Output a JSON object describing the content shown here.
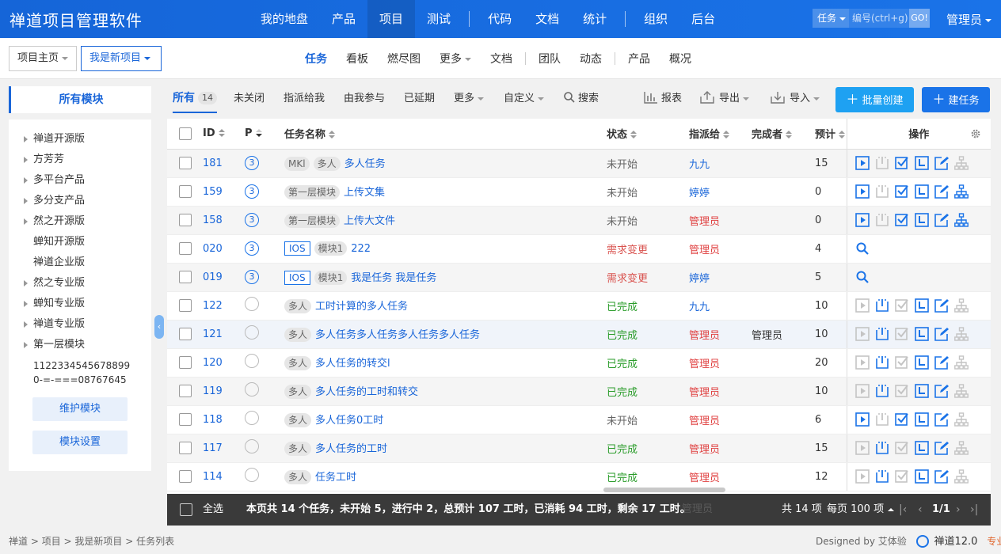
{
  "app": {
    "title": "禅道项目管理软件"
  },
  "main_nav": {
    "items": [
      "我的地盘",
      "产品",
      "项目",
      "测试",
      "代码",
      "文档",
      "统计",
      "组织",
      "后台"
    ],
    "active": "项目"
  },
  "search": {
    "type_label": "任务",
    "placeholder": "编号(ctrl+g)",
    "go_label": "GO!"
  },
  "user": {
    "name": "管理员"
  },
  "breadcrumb": {
    "home": "项目主页",
    "project": "我是新项目"
  },
  "sub_nav": {
    "items": [
      "任务",
      "看板",
      "燃尽图",
      "更多",
      "文档",
      "团队",
      "动态",
      "产品",
      "概况"
    ],
    "active": "任务"
  },
  "sidebar": {
    "title": "所有模块",
    "modules": [
      {
        "label": "禅道开源版",
        "expandable": true
      },
      {
        "label": "方芳芳",
        "expandable": true
      },
      {
        "label": "多平台产品",
        "expandable": true
      },
      {
        "label": "多分支产品",
        "expandable": true
      },
      {
        "label": "然之开源版",
        "expandable": true
      },
      {
        "label": "蝉知开源版",
        "expandable": false
      },
      {
        "label": "禅道企业版",
        "expandable": false
      },
      {
        "label": "然之专业版",
        "expandable": true
      },
      {
        "label": "蝉知专业版",
        "expandable": true
      },
      {
        "label": "禅道专业版",
        "expandable": true
      },
      {
        "label": "第一层模块",
        "expandable": true
      }
    ],
    "long_module_line1": "1122334545678899",
    "long_module_line2": "0-=-===08767645",
    "maintain_button": "维护模块",
    "settings_button": "模块设置"
  },
  "toolbar": {
    "all_label": "所有",
    "all_count": "14",
    "unclosed": "未关闭",
    "assigned_to_me": "指派给我",
    "involved": "由我参与",
    "delayed": "已延期",
    "more": "更多",
    "custom": "自定义",
    "search": "搜索",
    "report": "报表",
    "export": "导出",
    "import": "导入",
    "batch_create": "批量创建",
    "create_task": "建任务"
  },
  "table": {
    "headers": {
      "id": "ID",
      "pri": "P",
      "name": "任务名称",
      "status": "状态",
      "assigned": "指派给",
      "finished_by": "完成者",
      "estimate": "预计",
      "actions": "操作"
    },
    "rows": [
      {
        "id": "181",
        "pri": "3",
        "tags": [
          {
            "text": "MKl",
            "style": "pill"
          },
          {
            "text": "多人",
            "style": "pill"
          }
        ],
        "name": "多人任务",
        "status": "未开始",
        "status_color": "gray",
        "assigned": "九九",
        "assigned_color": "blue",
        "finished_by": "",
        "estimate": "15",
        "ops": "full-active-tree",
        "shade": true
      },
      {
        "id": "159",
        "pri": "3",
        "tags": [
          {
            "text": "第一层模块",
            "style": "pill"
          }
        ],
        "name": "上传文集",
        "status": "未开始",
        "status_color": "gray",
        "assigned": "婷婷",
        "assigned_color": "blue",
        "finished_by": "",
        "estimate": "0",
        "ops": "full-active-treeblue",
        "shade": false
      },
      {
        "id": "158",
        "pri": "3",
        "tags": [
          {
            "text": "第一层模块",
            "style": "pill"
          }
        ],
        "name": "上传大文件",
        "status": "未开始",
        "status_color": "gray",
        "assigned": "管理员",
        "assigned_color": "red",
        "finished_by": "",
        "estimate": "0",
        "ops": "full-active-treeblue",
        "shade": true
      },
      {
        "id": "020",
        "pri": "3",
        "tags": [
          {
            "text": "IOS",
            "style": "box"
          },
          {
            "text": "模块1",
            "style": "pill"
          }
        ],
        "name": "222",
        "status": "需求变更",
        "status_color": "red",
        "assigned": "管理员",
        "assigned_color": "red",
        "finished_by": "",
        "estimate": "4",
        "ops": "search",
        "shade": false
      },
      {
        "id": "019",
        "pri": "3",
        "tags": [
          {
            "text": "IOS",
            "style": "box"
          },
          {
            "text": "模块1",
            "style": "pill"
          }
        ],
        "name": "我是任务 我是任务",
        "status": "需求变更",
        "status_color": "red",
        "assigned": "婷婷",
        "assigned_color": "blue",
        "finished_by": "",
        "estimate": "5",
        "ops": "search",
        "shade": true
      },
      {
        "id": "122",
        "pri": "",
        "tags": [
          {
            "text": "多人",
            "style": "pill"
          }
        ],
        "name": "工时计算的多人任务",
        "status": "已完成",
        "status_color": "green",
        "assigned": "九九",
        "assigned_color": "blue",
        "finished_by": "",
        "estimate": "10",
        "ops": "done",
        "shade": false
      },
      {
        "id": "121",
        "pri": "",
        "tags": [
          {
            "text": "多人",
            "style": "pill"
          }
        ],
        "name": "多人任务多人任务多人任务多人任务",
        "status": "已完成",
        "status_color": "green",
        "assigned": "管理员",
        "assigned_color": "red",
        "finished_by": "管理员",
        "estimate": "10",
        "ops": "done",
        "shade": "hover"
      },
      {
        "id": "120",
        "pri": "",
        "tags": [
          {
            "text": "多人",
            "style": "pill"
          }
        ],
        "name": "多人任务的转交l",
        "status": "已完成",
        "status_color": "green",
        "assigned": "管理员",
        "assigned_color": "red",
        "finished_by": "",
        "estimate": "20",
        "ops": "done",
        "shade": false
      },
      {
        "id": "119",
        "pri": "",
        "tags": [
          {
            "text": "多人",
            "style": "pill"
          }
        ],
        "name": "多人任务的工时和转交",
        "status": "已完成",
        "status_color": "green",
        "assigned": "管理员",
        "assigned_color": "red",
        "finished_by": "",
        "estimate": "10",
        "ops": "done",
        "shade": true
      },
      {
        "id": "118",
        "pri": "",
        "tags": [
          {
            "text": "多人",
            "style": "pill"
          }
        ],
        "name": "多人任务0工时",
        "status": "未开始",
        "status_color": "gray",
        "assigned": "管理员",
        "assigned_color": "red",
        "finished_by": "",
        "estimate": "6",
        "ops": "notstarted-multi",
        "shade": false
      },
      {
        "id": "117",
        "pri": "",
        "tags": [
          {
            "text": "多人",
            "style": "pill"
          }
        ],
        "name": "多人任务的工时",
        "status": "已完成",
        "status_color": "green",
        "assigned": "管理员",
        "assigned_color": "red",
        "finished_by": "",
        "estimate": "15",
        "ops": "done",
        "shade": true
      },
      {
        "id": "114",
        "pri": "",
        "tags": [
          {
            "text": "多人",
            "style": "pill"
          }
        ],
        "name": "任务工时",
        "status": "已完成",
        "status_color": "green",
        "assigned": "管理员",
        "assigned_color": "red",
        "finished_by": "",
        "estimate": "12",
        "ops": "done",
        "shade": false
      }
    ]
  },
  "footer": {
    "select_all": "全选",
    "summary": "本页共 14 个任务，未开始 5，进行中 2，总预计 107 工时，已消耗 94 工时，剩余 17 工时。",
    "hidden_cell": "管理员",
    "total": "共 14 项",
    "per_page": "每页 100 项",
    "page": "1/1"
  },
  "status_bar": {
    "path": [
      "禅道",
      "项目",
      "我是新项目",
      "任务列表"
    ],
    "designed_by": "Designed by 艾体验",
    "version": "禅道12.0",
    "edition": "专业版"
  },
  "colors": {
    "brand": "#1a73e8",
    "link": "#1a66d9",
    "green": "#2a9c2a",
    "red": "#e04141"
  }
}
